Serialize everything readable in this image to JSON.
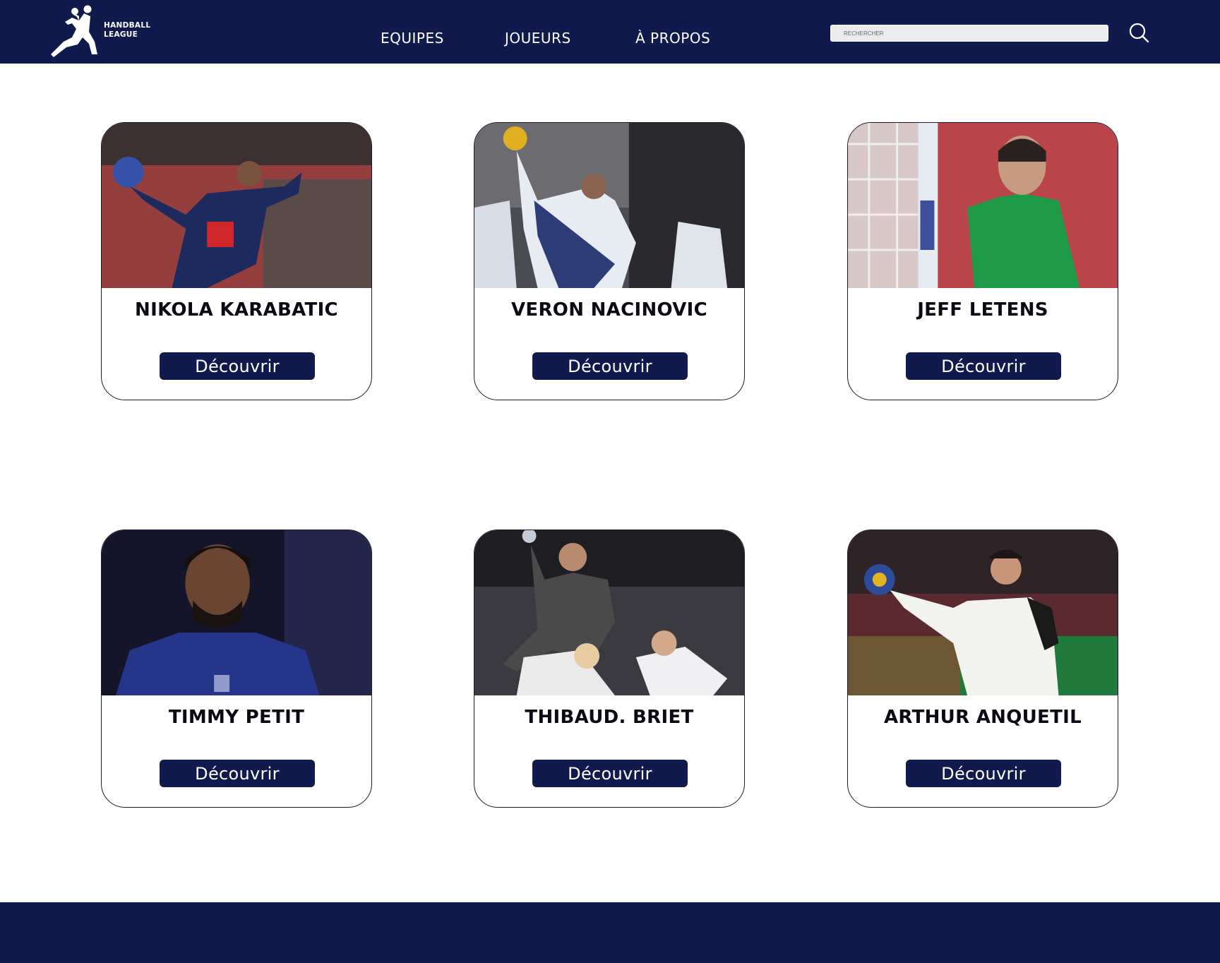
{
  "header": {
    "logo_line1": "HANDBALL",
    "logo_line2": "LEAGUE",
    "nav": [
      {
        "label": "EQUIPES"
      },
      {
        "label": "JOUEURS"
      },
      {
        "label": "À PROPOS"
      }
    ],
    "search": {
      "placeholder": "RECHERCHER",
      "icon": "search-icon"
    }
  },
  "colors": {
    "brand": "#111a4d",
    "card_border": "#1a1a2a"
  },
  "players": [
    {
      "name": "NIKOLA KARABATIC",
      "button": "Découvrir"
    },
    {
      "name": "VERON NACINOVIC",
      "button": "Découvrir"
    },
    {
      "name": "JEFF LETENS",
      "button": "Découvrir"
    },
    {
      "name": "TIMMY PETIT",
      "button": "Découvrir"
    },
    {
      "name": "THIBAUD. BRIET",
      "button": "Découvrir"
    },
    {
      "name": "ARTHUR ANQUETIL",
      "button": "Découvrir"
    }
  ]
}
